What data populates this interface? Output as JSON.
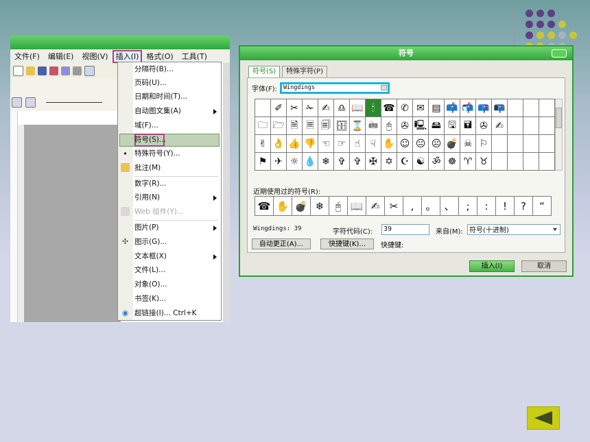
{
  "word_menu": {
    "items": [
      "文件(F)",
      "编辑(E)",
      "视图(V)",
      "插入(I)",
      "格式(O)",
      "工具(T)"
    ],
    "active_index": 3
  },
  "insert_menu": {
    "items": [
      {
        "label": "分隔符(B)...",
        "disabled": false,
        "submenu": false
      },
      {
        "label": "页码(U)...",
        "disabled": false,
        "submenu": false
      },
      {
        "label": "日期和时间(T)...",
        "disabled": false,
        "submenu": false
      },
      {
        "label": "自动图文集(A)",
        "disabled": false,
        "submenu": true
      },
      {
        "label": "域(F)...",
        "disabled": false,
        "submenu": false
      },
      {
        "label": "符号(S)...",
        "disabled": false,
        "submenu": false,
        "highlighted": true
      },
      {
        "label": "特殊符号(Y)...",
        "disabled": false,
        "submenu": false
      },
      {
        "label": "批注(M)",
        "disabled": false,
        "submenu": false
      },
      {
        "label": "数字(R)...",
        "disabled": false,
        "submenu": false
      },
      {
        "label": "引用(N)",
        "disabled": false,
        "submenu": true
      },
      {
        "label": "Web 组件(Y)...",
        "disabled": true,
        "submenu": false
      },
      {
        "label": "图片(P)",
        "disabled": false,
        "submenu": true
      },
      {
        "label": "图示(G)...",
        "disabled": false,
        "submenu": false
      },
      {
        "label": "文本框(X)",
        "disabled": false,
        "submenu": true
      },
      {
        "label": "文件(L)...",
        "disabled": false,
        "submenu": false
      },
      {
        "label": "对象(O)...",
        "disabled": false,
        "submenu": false
      },
      {
        "label": "书签(K)...",
        "disabled": false,
        "submenu": false
      },
      {
        "label": "超链接(I)...   Ctrl+K",
        "disabled": false,
        "submenu": false
      }
    ]
  },
  "dialog": {
    "title": "符号",
    "tabs": [
      "符号(S)",
      "特殊字符(P)"
    ],
    "font_label": "字体(F):",
    "font_value": "Wingdings",
    "symbols": [
      "",
      "✐",
      "✂",
      "✁",
      "✍",
      "♎",
      "📖",
      "🕯",
      "☎",
      "✆",
      "✉",
      "▤",
      "📫",
      "📬",
      "📪",
      "📭",
      "",
      "",
      "",
      "🗀",
      "🗁",
      "🗎",
      "🗏",
      "🗐",
      "🗄",
      "⌛",
      "🖮",
      "🖰",
      "✇",
      "🖳",
      "🖴",
      "🖫",
      "🖬",
      "✇",
      "✍",
      "",
      "",
      "",
      "✌",
      "👌",
      "👍",
      "👎",
      "☜",
      "☞",
      "☝",
      "☟",
      "✋",
      "☺",
      "😐",
      "☹",
      "💣",
      "☠",
      "⚐",
      "",
      "",
      "",
      "",
      "⚑",
      "✈",
      "☼",
      "💧",
      "❄",
      "✞",
      "✞",
      "✠",
      "✡",
      "☪",
      "☯",
      "ॐ",
      "☸",
      "♈",
      "♉",
      "",
      "",
      "",
      ""
    ],
    "selected_index": 7,
    "recent_label": "近期使用过的符号(R):",
    "recent": [
      "☎",
      "✋",
      "💣",
      "❄",
      "🖰",
      "📖",
      "✍",
      "✂",
      ",",
      "。",
      "、",
      ";",
      ":",
      "!",
      "?",
      "“"
    ],
    "charinfo": "Wingdings: 39",
    "code_label": "字符代码(C):",
    "code_value": "39",
    "from_label": "来自(M):",
    "from_value": "符号(十进制)",
    "autocorrect_btn": "自动更正(A)...",
    "shortcut_btn": "快捷键(K)...",
    "shortcut_label": "快捷键:",
    "insert_btn": "插入(I)",
    "cancel_btn": "取消"
  },
  "colors": {
    "accent_green": "#2fa53a",
    "highlight_magenta": "#a8447a",
    "font_box_cyan": "#16b6dd",
    "back_button": "#c9ce10"
  }
}
